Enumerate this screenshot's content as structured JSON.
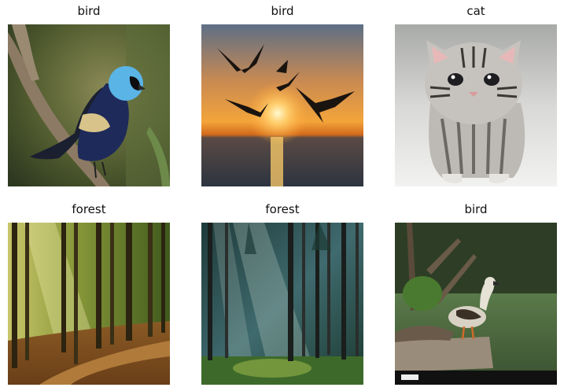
{
  "grid": {
    "items": [
      {
        "label": "bird"
      },
      {
        "label": "bird"
      },
      {
        "label": "cat"
      },
      {
        "label": "forest"
      },
      {
        "label": "forest"
      },
      {
        "label": "bird"
      }
    ]
  }
}
